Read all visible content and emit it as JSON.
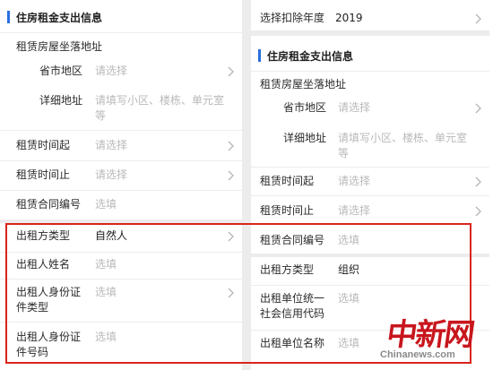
{
  "left": {
    "section_title": "住房租金支出信息",
    "address_header": "租赁房屋坐落地址",
    "province_label": "省市地区",
    "province_placeholder": "请选择",
    "address_label": "详细地址",
    "address_placeholder_line1": "请填写小区、楼栋、单元室",
    "address_placeholder_line2": "等",
    "start_label": "租赁时间起",
    "start_placeholder": "请选择",
    "end_label": "租赁时间止",
    "end_placeholder": "请选择",
    "contract_label": "租赁合同编号",
    "contract_placeholder": "选填",
    "lessor_type_label": "出租方类型",
    "lessor_type_value": "自然人",
    "lessor_name_label": "出租人姓名",
    "lessor_name_placeholder": "选填",
    "id_type_label_line1": "出租人身份证",
    "id_type_label_line2": "件类型",
    "id_type_placeholder": "选填",
    "id_no_label_line1": "出租人身份证",
    "id_no_label_line2": "件号码",
    "id_no_placeholder": "选填"
  },
  "right": {
    "year_label": "选择扣除年度",
    "year_value": "2019",
    "section_title": "住房租金支出信息",
    "address_header": "租赁房屋坐落地址",
    "province_label": "省市地区",
    "province_placeholder": "请选择",
    "address_label": "详细地址",
    "address_placeholder_line1": "请填写小区、楼栋、单元室",
    "address_placeholder_line2": "等",
    "start_label": "租赁时间起",
    "start_placeholder": "请选择",
    "end_label": "租赁时间止",
    "end_placeholder": "请选择",
    "contract_label": "租赁合同编号",
    "contract_placeholder": "选填",
    "lessor_type_label": "出租方类型",
    "lessor_type_value": "组织",
    "credit_code_label_line1": "出租单位统一",
    "credit_code_label_line2": "社会信用代码",
    "credit_code_placeholder": "选填",
    "org_name_label": "出租单位名称",
    "org_name_placeholder": "选填"
  },
  "watermark": {
    "chinese": "中新网",
    "english": "Chinanews.com"
  },
  "colors": {
    "accent": "#2a6fe0",
    "highlight_box": "#d9241c",
    "placeholder": "#b9b9b9",
    "watermark_red": "#c8161d"
  },
  "icons": {
    "chevron": "chevron-right-icon"
  }
}
